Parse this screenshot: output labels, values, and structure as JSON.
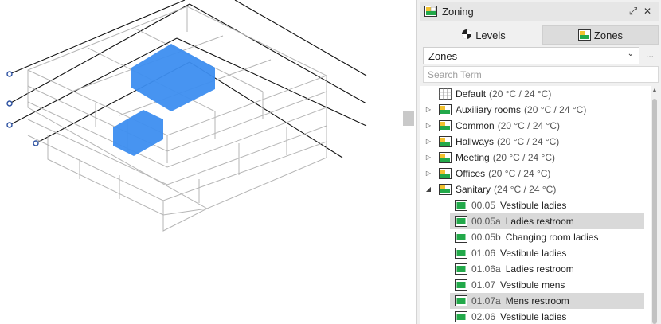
{
  "panel": {
    "title": "Zoning",
    "tabs": [
      {
        "label": "Levels",
        "icon": "levels-icon"
      },
      {
        "label": "Zones",
        "icon": "zones-icon",
        "active": true
      }
    ],
    "dropdown": {
      "value": "Zones"
    },
    "more_label": "...",
    "search": {
      "placeholder": "Search Term",
      "value": ""
    }
  },
  "tree": {
    "groups": [
      {
        "label": "Default",
        "temp": "(20 °C / 24 °C)",
        "expandable": false,
        "icon": "default-zone-icon"
      },
      {
        "label": "Auxiliary rooms",
        "temp": "(20 °C / 24 °C)",
        "expandable": true,
        "expanded": false
      },
      {
        "label": "Common",
        "temp": "(20 °C / 24 °C)",
        "expandable": true,
        "expanded": false
      },
      {
        "label": "Hallways",
        "temp": "(20 °C / 24 °C)",
        "expandable": true,
        "expanded": false
      },
      {
        "label": "Meeting",
        "temp": "(20 °C / 24 °C)",
        "expandable": true,
        "expanded": false
      },
      {
        "label": "Offices",
        "temp": "(20 °C / 24 °C)",
        "expandable": true,
        "expanded": false
      },
      {
        "label": "Sanitary",
        "temp": "(24 °C / 24 °C)",
        "expandable": true,
        "expanded": true
      }
    ],
    "rooms": [
      {
        "id": "00.05",
        "name": "Vestibule ladies",
        "selected": false
      },
      {
        "id": "00.05a",
        "name": "Ladies restroom",
        "selected": true
      },
      {
        "id": "00.05b",
        "name": "Changing room ladies",
        "selected": false
      },
      {
        "id": "01.06",
        "name": "Vestibule ladies",
        "selected": false
      },
      {
        "id": "01.06a",
        "name": "Ladies restroom",
        "selected": false
      },
      {
        "id": "01.07",
        "name": "Vestibule mens",
        "selected": false
      },
      {
        "id": "01.07a",
        "name": "Mens restroom",
        "selected": true
      },
      {
        "id": "02.06",
        "name": "Vestibule ladies",
        "selected": false
      }
    ]
  },
  "colors": {
    "highlight_zone": "#3d8ef0",
    "zone_icon_green": "#22a94a",
    "zone_icon_yellow": "#f2c230",
    "selection": "#d9d9d9"
  }
}
